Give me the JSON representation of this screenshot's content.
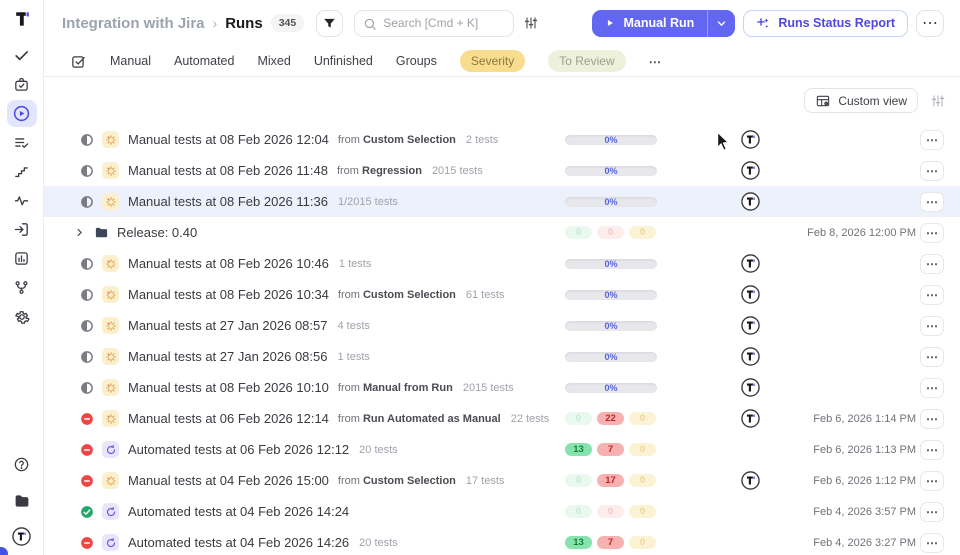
{
  "app": {
    "logo_initial": "T"
  },
  "sidebar": {
    "items": [
      {
        "icon": "check",
        "name": "tests"
      },
      {
        "icon": "bag",
        "name": "suites"
      },
      {
        "icon": "play",
        "name": "runs",
        "active": true
      },
      {
        "icon": "list-check",
        "name": "plans"
      },
      {
        "icon": "stairs",
        "name": "milestones"
      },
      {
        "icon": "pulse",
        "name": "analytics"
      },
      {
        "icon": "enter",
        "name": "imports"
      },
      {
        "icon": "chart",
        "name": "reports"
      },
      {
        "icon": "branch",
        "name": "branches"
      },
      {
        "icon": "gear",
        "name": "settings"
      }
    ],
    "bottom": [
      {
        "icon": "help",
        "name": "help"
      },
      {
        "icon": "folder-filled",
        "name": "projects"
      },
      {
        "icon": "avatar",
        "name": "account"
      }
    ]
  },
  "header": {
    "project": "Integration with Jira",
    "separator": "›",
    "page": "Runs",
    "count": "345",
    "search_placeholder": "Search [Cmd + K]",
    "manual_run": "Manual Run",
    "runs_status_report": "Runs Status Report",
    "more": "⋯"
  },
  "tabs": {
    "items": [
      "Manual",
      "Automated",
      "Mixed",
      "Unfinished",
      "Groups"
    ],
    "pills": [
      {
        "label": "Severity",
        "style": "yellow"
      },
      {
        "label": "To Review",
        "style": "pale"
      }
    ],
    "more": "⋯"
  },
  "toolbar": {
    "custom_view": "Custom view"
  },
  "labels": {
    "from_prefix": "from",
    "menu_dots": "⋯"
  },
  "rows": [
    {
      "kind": "run",
      "status": "in-progress",
      "run_type": "manual",
      "title": "Manual tests at 08 Feb 2026 12:04",
      "from": "Custom Selection",
      "tests": "2 tests",
      "progress": "0%",
      "badges": null,
      "assignee": true,
      "date": "",
      "highlighted": false
    },
    {
      "kind": "run",
      "status": "in-progress",
      "run_type": "manual",
      "title": "Manual tests at 08 Feb 2026 11:48",
      "from": "Regression",
      "tests": "2015 tests",
      "progress": "0%",
      "badges": null,
      "assignee": true,
      "date": "",
      "highlighted": false
    },
    {
      "kind": "run",
      "status": "in-progress",
      "run_type": "manual",
      "title": "Manual tests at 08 Feb 2026 11:36",
      "from": null,
      "tests": "1/2015 tests",
      "progress": "0%",
      "badges": null,
      "assignee": true,
      "date": "",
      "highlighted": true
    },
    {
      "kind": "release",
      "title": "Release: 0.40",
      "badges": [
        {
          "value": "0",
          "color": "green",
          "solid": false
        },
        {
          "value": "0",
          "color": "red",
          "solid": false
        },
        {
          "value": "0",
          "color": "yellow",
          "solid": false
        }
      ],
      "date": "Feb 8, 2026 12:00 PM"
    },
    {
      "kind": "run",
      "status": "in-progress",
      "run_type": "manual",
      "title": "Manual tests at 08 Feb 2026 10:46",
      "from": null,
      "tests": "1 tests",
      "progress": "0%",
      "badges": null,
      "assignee": true,
      "date": "",
      "highlighted": false
    },
    {
      "kind": "run",
      "status": "in-progress",
      "run_type": "manual",
      "title": "Manual tests at 08 Feb 2026 10:34",
      "from": "Custom Selection",
      "tests": "61 tests",
      "progress": "0%",
      "badges": null,
      "assignee": true,
      "date": "",
      "highlighted": false
    },
    {
      "kind": "run",
      "status": "in-progress",
      "run_type": "manual",
      "title": "Manual tests at 27 Jan 2026 08:57",
      "from": null,
      "tests": "4 tests",
      "progress": "0%",
      "badges": null,
      "assignee": true,
      "date": "",
      "highlighted": false
    },
    {
      "kind": "run",
      "status": "in-progress",
      "run_type": "manual",
      "title": "Manual tests at 27 Jan 2026 08:56",
      "from": null,
      "tests": "1 tests",
      "progress": "0%",
      "badges": null,
      "assignee": true,
      "date": "",
      "highlighted": false
    },
    {
      "kind": "run",
      "status": "in-progress",
      "run_type": "manual",
      "title": "Manual tests at 08 Feb 2026 10:10",
      "from": "Manual from Run",
      "tests": "2015 tests",
      "progress": "0%",
      "badges": null,
      "assignee": true,
      "date": "",
      "highlighted": false
    },
    {
      "kind": "run",
      "status": "failed",
      "run_type": "manual",
      "title": "Manual tests at 06 Feb 2026 12:14",
      "from": "Run Automated as Manual",
      "tests": "22 tests",
      "progress": null,
      "badges": [
        {
          "value": "0",
          "color": "green",
          "solid": false
        },
        {
          "value": "22",
          "color": "red",
          "solid": true
        },
        {
          "value": "0",
          "color": "yellow",
          "solid": false
        }
      ],
      "assignee": true,
      "date": "Feb 6, 2026 1:14 PM",
      "highlighted": false
    },
    {
      "kind": "run",
      "status": "failed",
      "run_type": "automated",
      "title": "Automated tests at 06 Feb 2026 12:12",
      "from": null,
      "tests": "20 tests",
      "progress": null,
      "badges": [
        {
          "value": "13",
          "color": "green",
          "solid": true
        },
        {
          "value": "7",
          "color": "red",
          "solid": true
        },
        {
          "value": "0",
          "color": "yellow",
          "solid": false
        }
      ],
      "assignee": false,
      "date": "Feb 6, 2026 1:13 PM",
      "highlighted": false
    },
    {
      "kind": "run",
      "status": "failed",
      "run_type": "manual",
      "title": "Manual tests at 04 Feb 2026 15:00",
      "from": "Custom Selection",
      "tests": "17 tests",
      "progress": null,
      "badges": [
        {
          "value": "0",
          "color": "green",
          "solid": false
        },
        {
          "value": "17",
          "color": "red",
          "solid": true
        },
        {
          "value": "0",
          "color": "yellow",
          "solid": false
        }
      ],
      "assignee": true,
      "date": "Feb 6, 2026 1:12 PM",
      "highlighted": false
    },
    {
      "kind": "run",
      "status": "passed",
      "run_type": "automated",
      "title": "Automated tests at 04 Feb 2026 14:24",
      "from": null,
      "tests": "",
      "progress": null,
      "badges": [
        {
          "value": "0",
          "color": "green",
          "solid": false
        },
        {
          "value": "0",
          "color": "red",
          "solid": false
        },
        {
          "value": "0",
          "color": "yellow",
          "solid": false
        }
      ],
      "assignee": false,
      "date": "Feb 4, 2026 3:57 PM",
      "highlighted": false
    },
    {
      "kind": "run",
      "status": "failed",
      "run_type": "automated",
      "title": "Automated tests at 04 Feb 2026 14:26",
      "from": null,
      "tests": "20 tests",
      "progress": null,
      "badges": [
        {
          "value": "13",
          "color": "green",
          "solid": true
        },
        {
          "value": "7",
          "color": "red",
          "solid": true
        },
        {
          "value": "0",
          "color": "yellow",
          "solid": false
        }
      ],
      "assignee": false,
      "date": "Feb 4, 2026 3:27 PM",
      "highlighted": false
    }
  ],
  "colors": {
    "accent": "#6366f1",
    "accent_dark": "#4f46e5",
    "passed_badge": "#88e2ac",
    "failed_badge": "#f8b1b1",
    "severity_pill": "#f7dd8d",
    "to_review_pill": "#edf1dc",
    "progress_label": "#5563de",
    "row_highlight": "#edf1fc"
  }
}
